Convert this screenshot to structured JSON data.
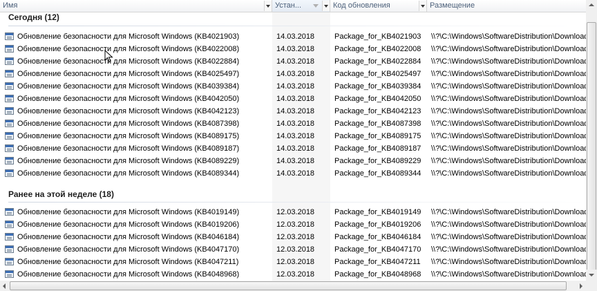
{
  "columns": {
    "name": "Имя",
    "installed": "Устан...",
    "code": "Код обновления",
    "location": "Размещение"
  },
  "groups": [
    {
      "header": "Сегодня (12)",
      "rows": [
        {
          "name": "Обновление безопасности для Microsoft Windows (KB4021903)",
          "date": "14.03.2018",
          "code": "Package_for_KB4021903",
          "location": "\\\\?\\C:\\Windows\\SoftwareDistribution\\Download"
        },
        {
          "name": "Обновление безопасности для Microsoft Windows (KB4022008)",
          "date": "14.03.2018",
          "code": "Package_for_KB4022008",
          "location": "\\\\?\\C:\\Windows\\SoftwareDistribution\\Download"
        },
        {
          "name": "Обновление безопасности для Microsoft Windows (KB4022884)",
          "date": "14.03.2018",
          "code": "Package_for_KB4022884",
          "location": "\\\\?\\C:\\Windows\\SoftwareDistribution\\Download"
        },
        {
          "name": "Обновление безопасности для Microsoft Windows (KB4025497)",
          "date": "14.03.2018",
          "code": "Package_for_KB4025497",
          "location": "\\\\?\\C:\\Windows\\SoftwareDistribution\\Download"
        },
        {
          "name": "Обновление безопасности для Microsoft Windows (KB4039384)",
          "date": "14.03.2018",
          "code": "Package_for_KB4039384",
          "location": "\\\\?\\C:\\Windows\\SoftwareDistribution\\Download"
        },
        {
          "name": "Обновление безопасности для Microsoft Windows (KB4042050)",
          "date": "14.03.2018",
          "code": "Package_for_KB4042050",
          "location": "\\\\?\\C:\\Windows\\SoftwareDistribution\\Download"
        },
        {
          "name": "Обновление безопасности для Microsoft Windows (KB4042123)",
          "date": "14.03.2018",
          "code": "Package_for_KB4042123",
          "location": "\\\\?\\C:\\Windows\\SoftwareDistribution\\Download"
        },
        {
          "name": "Обновление безопасности для Microsoft Windows (KB4087398)",
          "date": "14.03.2018",
          "code": "Package_for_KB4087398",
          "location": "\\\\?\\C:\\Windows\\SoftwareDistribution\\Download"
        },
        {
          "name": "Обновление безопасности для Microsoft Windows (KB4089175)",
          "date": "14.03.2018",
          "code": "Package_for_KB4089175",
          "location": "\\\\?\\C:\\Windows\\SoftwareDistribution\\Download"
        },
        {
          "name": "Обновление безопасности для Microsoft Windows (KB4089187)",
          "date": "14.03.2018",
          "code": "Package_for_KB4089187",
          "location": "\\\\?\\C:\\Windows\\SoftwareDistribution\\Download"
        },
        {
          "name": "Обновление безопасности для Microsoft Windows (KB4089229)",
          "date": "14.03.2018",
          "code": "Package_for_KB4089229",
          "location": "\\\\?\\C:\\Windows\\SoftwareDistribution\\Download"
        },
        {
          "name": "Обновление безопасности для Microsoft Windows (KB4089344)",
          "date": "14.03.2018",
          "code": "Package_for_KB4089344",
          "location": "\\\\?\\C:\\Windows\\SoftwareDistribution\\Download"
        }
      ]
    },
    {
      "header": "Ранее на этой неделе (18)",
      "rows": [
        {
          "name": "Обновление безопасности для Microsoft Windows (KB4019149)",
          "date": "12.03.2018",
          "code": "Package_for_KB4019149",
          "location": "\\\\?\\C:\\Windows\\SoftwareDistribution\\Download"
        },
        {
          "name": "Обновление безопасности для Microsoft Windows (KB4019206)",
          "date": "12.03.2018",
          "code": "Package_for_KB4019206",
          "location": "\\\\?\\C:\\Windows\\SoftwareDistribution\\Download"
        },
        {
          "name": "Обновление безопасности для Microsoft Windows (KB4046184)",
          "date": "12.03.2018",
          "code": "Package_for_KB4046184",
          "location": "\\\\?\\C:\\Windows\\SoftwareDistribution\\Download"
        },
        {
          "name": "Обновление безопасности для Microsoft Windows (KB4047170)",
          "date": "12.03.2018",
          "code": "Package_for_KB4047170",
          "location": "\\\\?\\C:\\Windows\\SoftwareDistribution\\Download"
        },
        {
          "name": "Обновление безопасности для Microsoft Windows (KB4047211)",
          "date": "12.03.2018",
          "code": "Package_for_KB4047211",
          "location": "\\\\?\\C:\\Windows\\SoftwareDistribution\\Download"
        },
        {
          "name": "Обновление безопасности для Microsoft Windows (KB4048968)",
          "date": "12.03.2018",
          "code": "Package_for_KB4048968",
          "location": "\\\\?\\C:\\Windows\\SoftwareDistribution\\Download"
        }
      ]
    }
  ],
  "icons": {
    "row_icon": "update-package-icon",
    "column_menu": "chevron-down-icon",
    "sort": "sort-descending-icon",
    "cursor": "mouse-pointer-icon"
  }
}
